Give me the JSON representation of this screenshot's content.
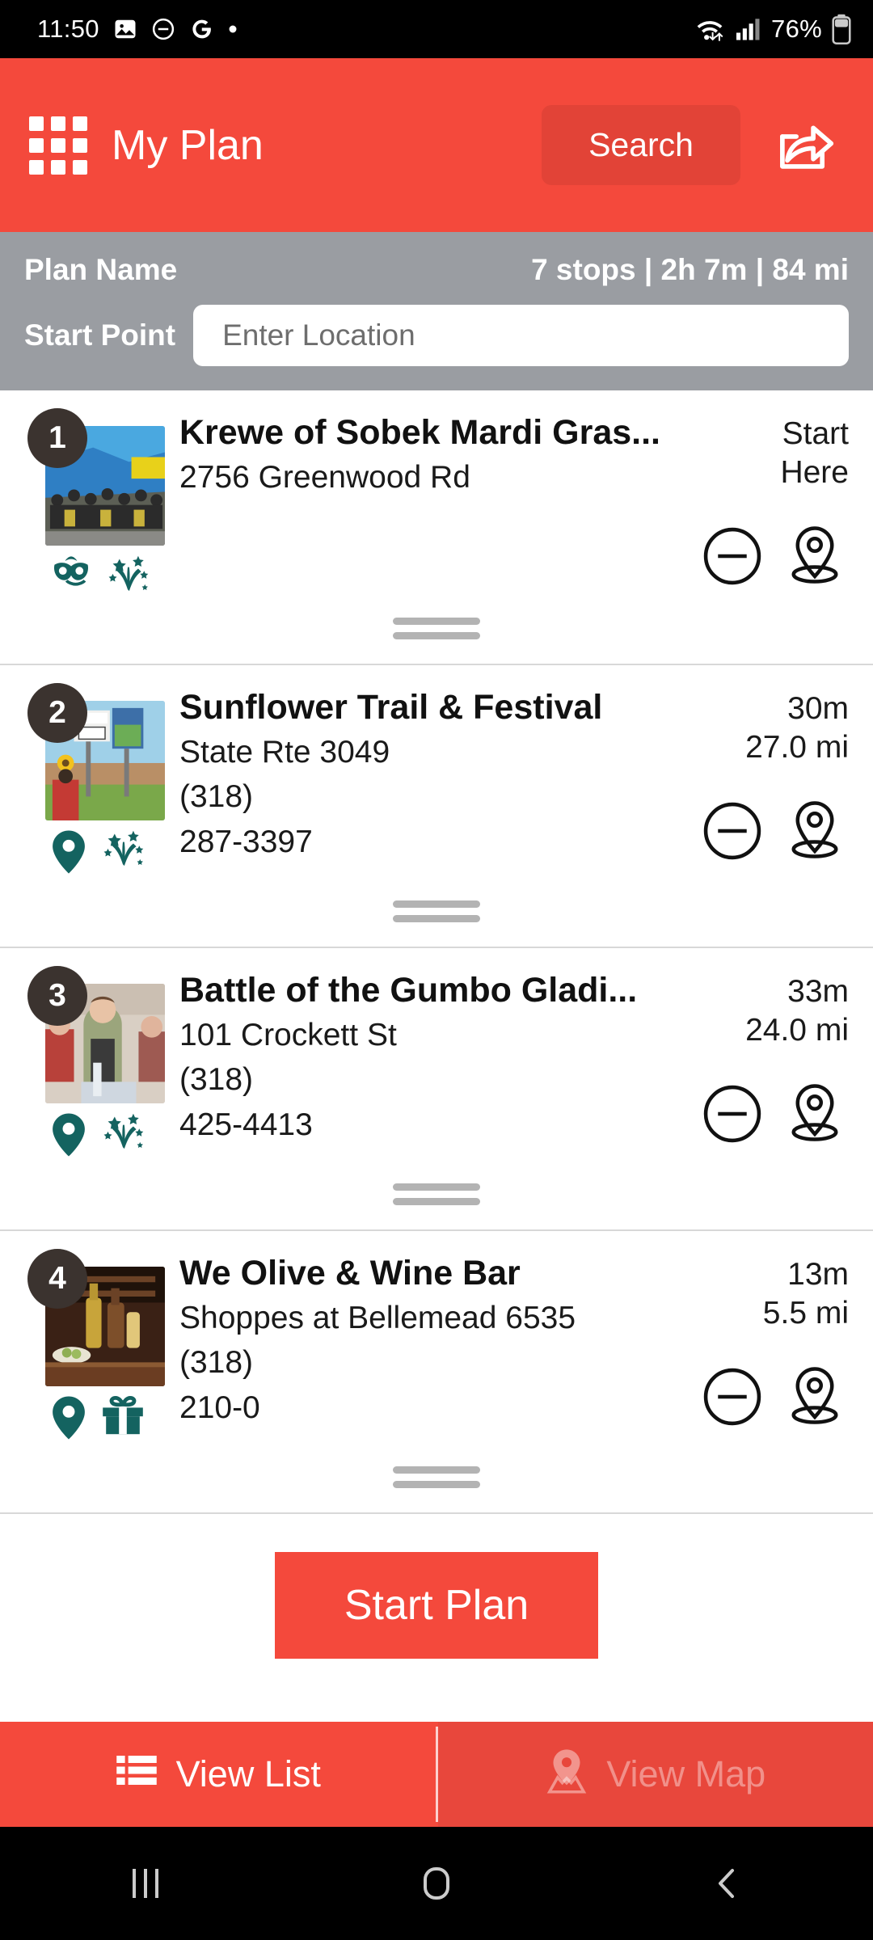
{
  "status_bar": {
    "time": "11:50",
    "battery_percent": "76%",
    "icons": [
      "image-icon",
      "do-not-disturb-icon",
      "google-icon",
      "dot-icon",
      "wifi-icon",
      "cellular-signal-icon",
      "battery-icon"
    ]
  },
  "header": {
    "menu_icon": "grid-menu-icon",
    "title": "My Plan",
    "search_label": "Search",
    "share_icon": "share-icon",
    "background_color": "#F4493C"
  },
  "plan_bar": {
    "name_label": "Plan Name",
    "stats": "7 stops | 2h 7m | 84 mi",
    "stops_count": "7 stops",
    "duration": "2h 7m",
    "distance": "84 mi",
    "start_point_label": "Start Point",
    "start_point_value": "",
    "start_point_placeholder": "Enter Location",
    "background_color": "#9A9DA2"
  },
  "stops": [
    {
      "number": "1",
      "title": "Krewe of Sobek Mardi Gras...",
      "address": "2756 Greenwood Rd",
      "phone_area": "",
      "phone_number": "",
      "time": "Start",
      "distance": "Here",
      "category_icons": [
        "mardi-gras-mask-icon",
        "fireworks-icon"
      ],
      "remove_icon": "minus-circle-icon",
      "locate_icon": "map-pin-icon"
    },
    {
      "number": "2",
      "title": "Sunflower Trail & Festival",
      "address": "State Rte 3049",
      "phone_area": "(318)",
      "phone_number": "287-3397",
      "time": "30m",
      "distance": "27.0 mi",
      "category_icons": [
        "map-pin-icon",
        "fireworks-icon"
      ],
      "remove_icon": "minus-circle-icon",
      "locate_icon": "map-pin-icon"
    },
    {
      "number": "3",
      "title": "Battle of the Gumbo Gladi...",
      "address": "101 Crockett St",
      "phone_area": "(318)",
      "phone_number": "425-4413",
      "time": "33m",
      "distance": "24.0 mi",
      "category_icons": [
        "map-pin-icon",
        "fireworks-icon"
      ],
      "remove_icon": "minus-circle-icon",
      "locate_icon": "map-pin-icon"
    },
    {
      "number": "4",
      "title": "We Olive & Wine Bar",
      "address": "Shoppes at Bellemead 6535",
      "phone_area": "(318)",
      "phone_number": "210-0",
      "time": "13m",
      "distance": "5.5 mi",
      "category_icons": [
        "map-pin-icon",
        "gift-icon"
      ],
      "remove_icon": "minus-circle-icon",
      "locate_icon": "map-pin-icon"
    }
  ],
  "start_plan_button": {
    "label": "Start Plan",
    "color": "#F4493C"
  },
  "bottom_tabs": [
    {
      "label": "View List",
      "icon": "list-icon",
      "active": true
    },
    {
      "label": "View Map",
      "icon": "map-pin-icon",
      "active": false
    }
  ],
  "nav_bar": {
    "recents_icon": "recents-icon",
    "home_icon": "home-icon",
    "back_icon": "back-icon"
  }
}
